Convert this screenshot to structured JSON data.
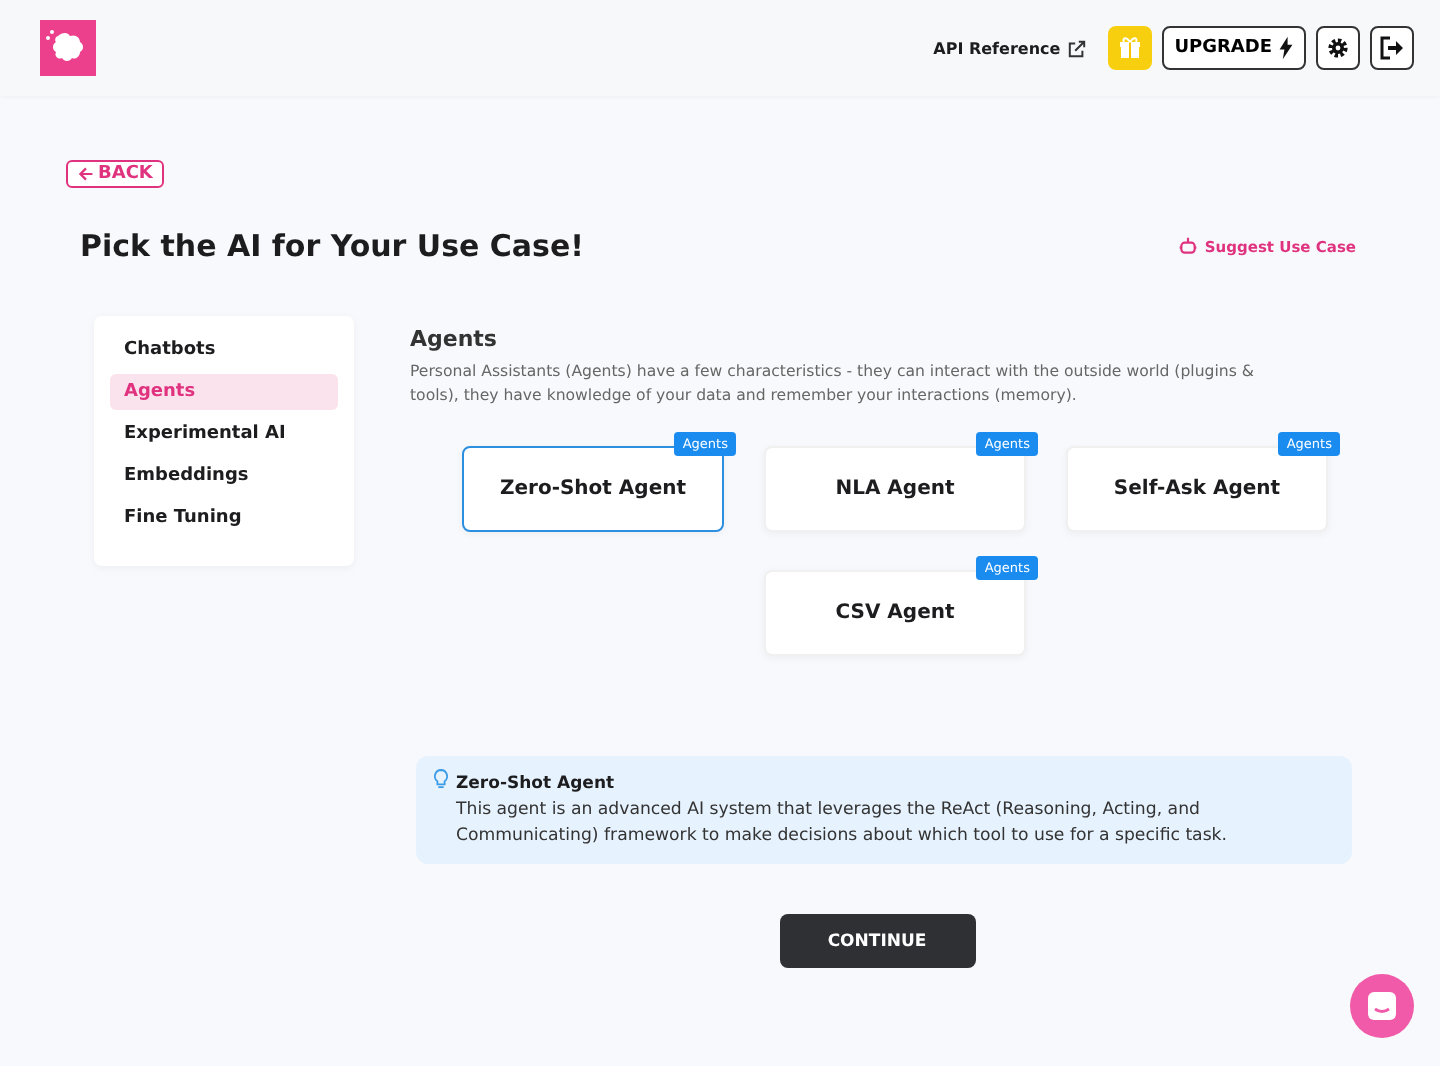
{
  "header": {
    "api_link": "API Reference",
    "upgrade": "UPGRADE"
  },
  "back": "BACK",
  "title": "Pick the AI for Your Use Case!",
  "suggest": "Suggest Use Case",
  "sidebar": {
    "items": [
      {
        "label": "Chatbots",
        "selected": false
      },
      {
        "label": "Agents",
        "selected": true
      },
      {
        "label": "Experimental AI",
        "selected": false
      },
      {
        "label": "Embeddings",
        "selected": false
      },
      {
        "label": "Fine Tuning",
        "selected": false
      }
    ]
  },
  "section": {
    "heading": "Agents",
    "description": "Personal Assistants (Agents) have a few characteristics - they can interact with the outside world (plugins & tools), they have knowledge of your data and remember your interactions (memory)."
  },
  "cards": [
    {
      "name": "Zero-Shot Agent",
      "tag": "Agents",
      "selected": true
    },
    {
      "name": "NLA Agent",
      "tag": "Agents",
      "selected": false
    },
    {
      "name": "Self-Ask Agent",
      "tag": "Agents",
      "selected": false
    },
    {
      "name": "CSV Agent",
      "tag": "Agents",
      "selected": false
    }
  ],
  "info": {
    "title": "Zero-Shot Agent",
    "text": "This agent is an advanced AI system that leverages the ReAct (Reasoning, Acting, and Communicating) framework to make decisions about which tool to use for a specific task."
  },
  "continue": "CONTINUE"
}
